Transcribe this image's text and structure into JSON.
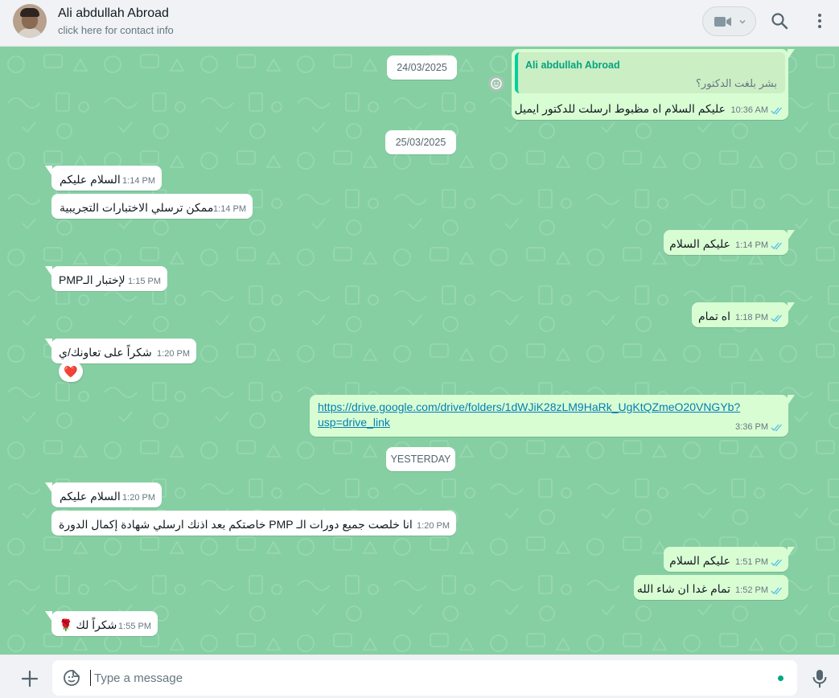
{
  "header": {
    "contact_name": "Ali abdullah Abroad",
    "contact_subtitle": "click here for contact info",
    "avatar_icon": "avatar-photo",
    "video_icon": "video-camera-icon",
    "search_icon": "search-icon",
    "menu_icon": "kebab-menu-icon"
  },
  "colors": {
    "chat_bg": "#86cfa3",
    "incoming_bubble": "#ffffff",
    "outgoing_bubble": "#d9fdd3",
    "read_ticks": "#53bdeb",
    "accent": "#00a884"
  },
  "dates": {
    "d1": "24/03/2025",
    "d2": "25/03/2025",
    "d3": "YESTERDAY"
  },
  "messages": {
    "m1": {
      "quote_name": "Ali abdullah Abroad",
      "quote_text": "بشر بلغت الدكتور؟",
      "text": "عليكم السلام اه مظبوط ارسلت للدكتور ايميل",
      "time": "10:36 AM",
      "status": "read"
    },
    "m2": {
      "text": "السلام عليكم",
      "time": "1:14 PM"
    },
    "m3": {
      "text": "ممكن ترسلي الاختبارات التجريبية",
      "time": "1:14 PM"
    },
    "m4": {
      "text": "عليكم السلام",
      "time": "1:14 PM",
      "status": "read"
    },
    "m5": {
      "text": "لإختبار الـPMP",
      "time": "1:15 PM"
    },
    "m6": {
      "text": "اه تمام",
      "time": "1:18 PM",
      "status": "read"
    },
    "m7": {
      "text": "شكراً على تعاونك/ي",
      "time": "1:20 PM",
      "reaction": "❤️"
    },
    "m8": {
      "link_line1": "https://drive.google.com/drive/folders/1dWJiK28zLM9HaRk_UgKtQZmeO20VNGYb?",
      "link_line2": "usp=drive_link",
      "time": "3:36 PM",
      "status": "read"
    },
    "m9": {
      "text": "السلام عليكم",
      "time": "1:20 PM"
    },
    "m10": {
      "text": "انا خلصت جميع دورات الـ PMP خاصتكم بعد اذنك ارسلي شهادة إكمال الدورة",
      "time": "1:20 PM"
    },
    "m11": {
      "text": "عليكم السلام",
      "time": "1:51 PM",
      "status": "read"
    },
    "m12": {
      "text": "تمام غدا ان شاء الله",
      "time": "1:52 PM",
      "status": "read"
    },
    "m13": {
      "text": "شكراً لك 🌹",
      "time": "1:55 PM"
    }
  },
  "composer": {
    "placeholder": "Type a message",
    "plus_icon": "plus-icon",
    "sticker_icon": "sticker-icon",
    "mic_icon": "microphone-icon"
  }
}
